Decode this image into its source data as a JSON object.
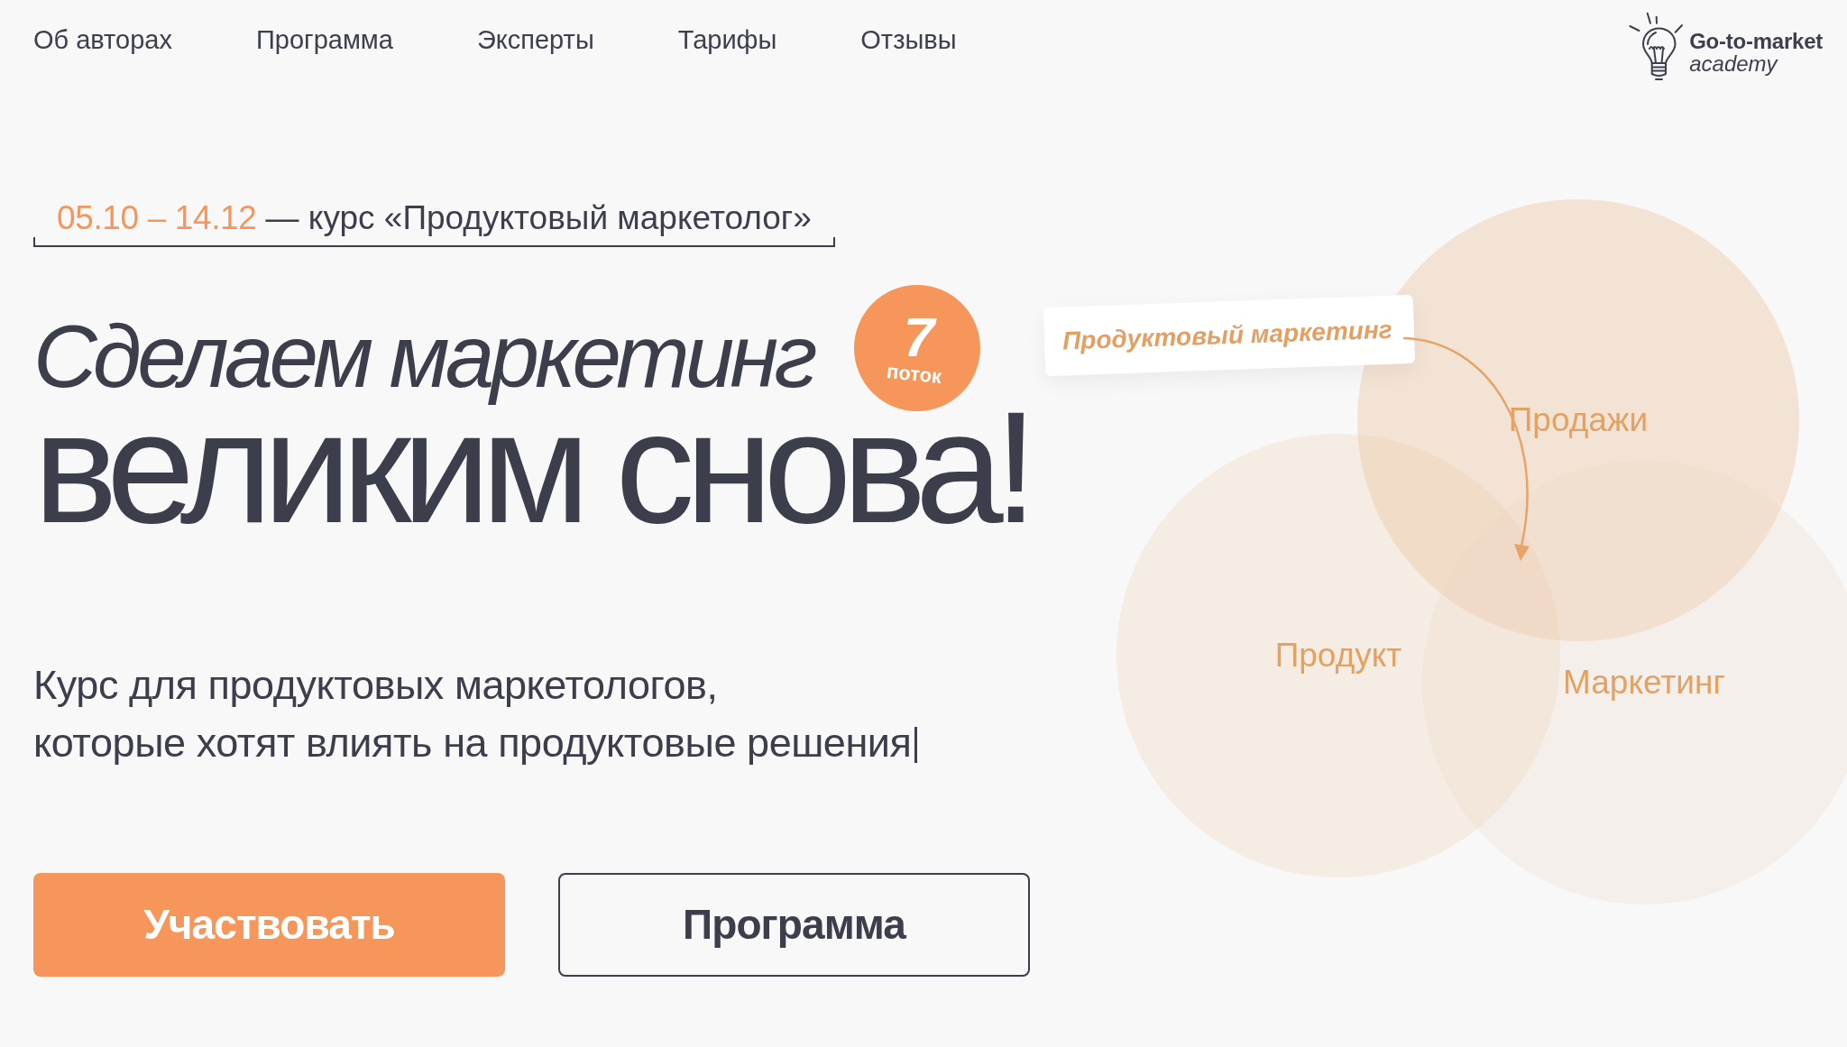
{
  "nav_items": [
    "Об авторах",
    "Программа",
    "Эксперты",
    "Тарифы",
    "Отзывы"
  ],
  "logo": {
    "title": "Go-to-market",
    "subtitle": "academy"
  },
  "hero": {
    "dates": "05.10 – 14.12",
    "course": "— курс «Продуктовый маркетолог»",
    "headline_line_1": "Сделаем маркетинг",
    "headline_line_2": "великим снова!",
    "badge": {
      "number": "7",
      "label": "поток"
    },
    "subtitle_lines": [
      "Курс для продуктовых маркетологов,",
      "которые хотят влиять на продуктовые решения"
    ],
    "buttons": [
      {
        "label": "Участвовать",
        "kind": "primary"
      },
      {
        "label": "Программа",
        "kind": "outline"
      }
    ]
  },
  "diagram": {
    "tag": "Продуктовый маркетинг",
    "circles": [
      {
        "label": "Продажи"
      },
      {
        "label": "Продукт"
      },
      {
        "label": "Маркетинг"
      }
    ]
  }
}
